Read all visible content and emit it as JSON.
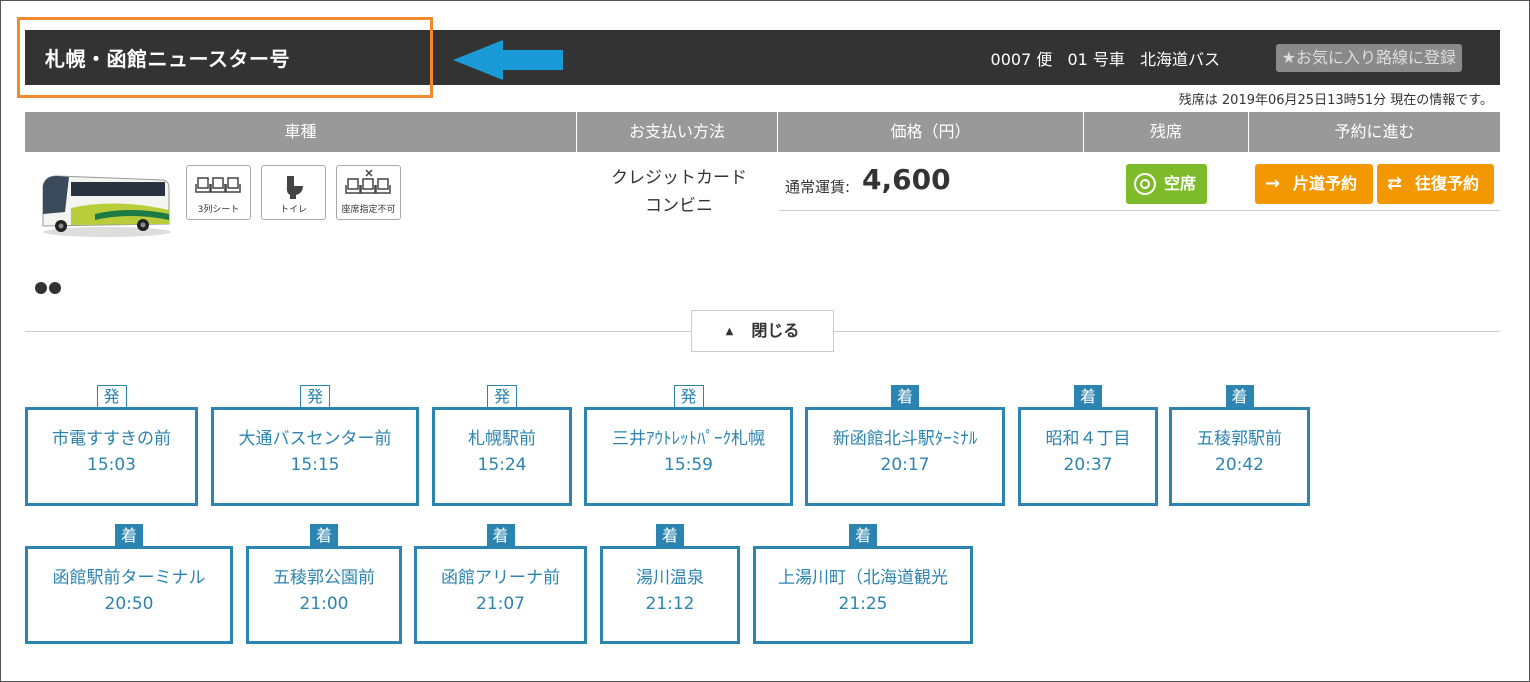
{
  "header": {
    "route_name": "札幌・函館ニュースター号",
    "flight_number": "0007 便",
    "car_number": "01 号車",
    "operator": "北海道バス",
    "favorite_label": "★お気に入り路線に登録"
  },
  "updated_note": "残席は 2019年06月25日13時51分 現在の情報です。",
  "table": {
    "headers": [
      "車種",
      "お支払い方法",
      "価格（円）",
      "残席",
      "予約に進む"
    ]
  },
  "features": [
    {
      "icon": "three-row-seat-icon",
      "label": "3列シート"
    },
    {
      "icon": "toilet-icon",
      "label": "トイレ"
    },
    {
      "icon": "no-seat-selection-icon",
      "label": "座席指定不可"
    }
  ],
  "payment_methods": [
    "クレジットカード",
    "コンビニ"
  ],
  "price": {
    "label": "通常運賃:",
    "value": "4,600"
  },
  "availability": {
    "label": "空席",
    "icon": "double-circle-icon"
  },
  "actions": {
    "oneway_label": "片道予約",
    "roundtrip_label": "往復予約"
  },
  "close_label": "閉じる",
  "stops_row1": [
    {
      "type": "発",
      "name": "市電すすきの前",
      "time": "15:03"
    },
    {
      "type": "発",
      "name": "大通バスセンター前",
      "time": "15:15"
    },
    {
      "type": "発",
      "name": "札幌駅前",
      "time": "15:24"
    },
    {
      "type": "発",
      "name": "三井ｱｳﾄﾚｯﾄﾊﾟｰｸ札幌",
      "time": "15:59"
    },
    {
      "type": "着",
      "name": "新函館北斗駅ﾀｰﾐﾅﾙ",
      "time": "20:17"
    },
    {
      "type": "着",
      "name": "昭和４丁目",
      "time": "20:37"
    },
    {
      "type": "着",
      "name": "五稜郭駅前",
      "time": "20:42"
    }
  ],
  "stops_row2": [
    {
      "type": "着",
      "name": "函館駅前ターミナル",
      "time": "20:50"
    },
    {
      "type": "着",
      "name": "五稜郭公園前",
      "time": "21:00"
    },
    {
      "type": "着",
      "name": "函館アリーナ前",
      "time": "21:07"
    },
    {
      "type": "着",
      "name": "湯川温泉",
      "time": "21:12"
    },
    {
      "type": "着",
      "name": "上湯川町（北海道観光",
      "time": "21:25"
    }
  ],
  "colors": {
    "header_bg": "#333333",
    "highlight": "#f28a30",
    "arrow": "#1a9ad6",
    "stop_border": "#2c84b0",
    "available": "#7dbb2b",
    "reserve_button": "#f39800"
  }
}
